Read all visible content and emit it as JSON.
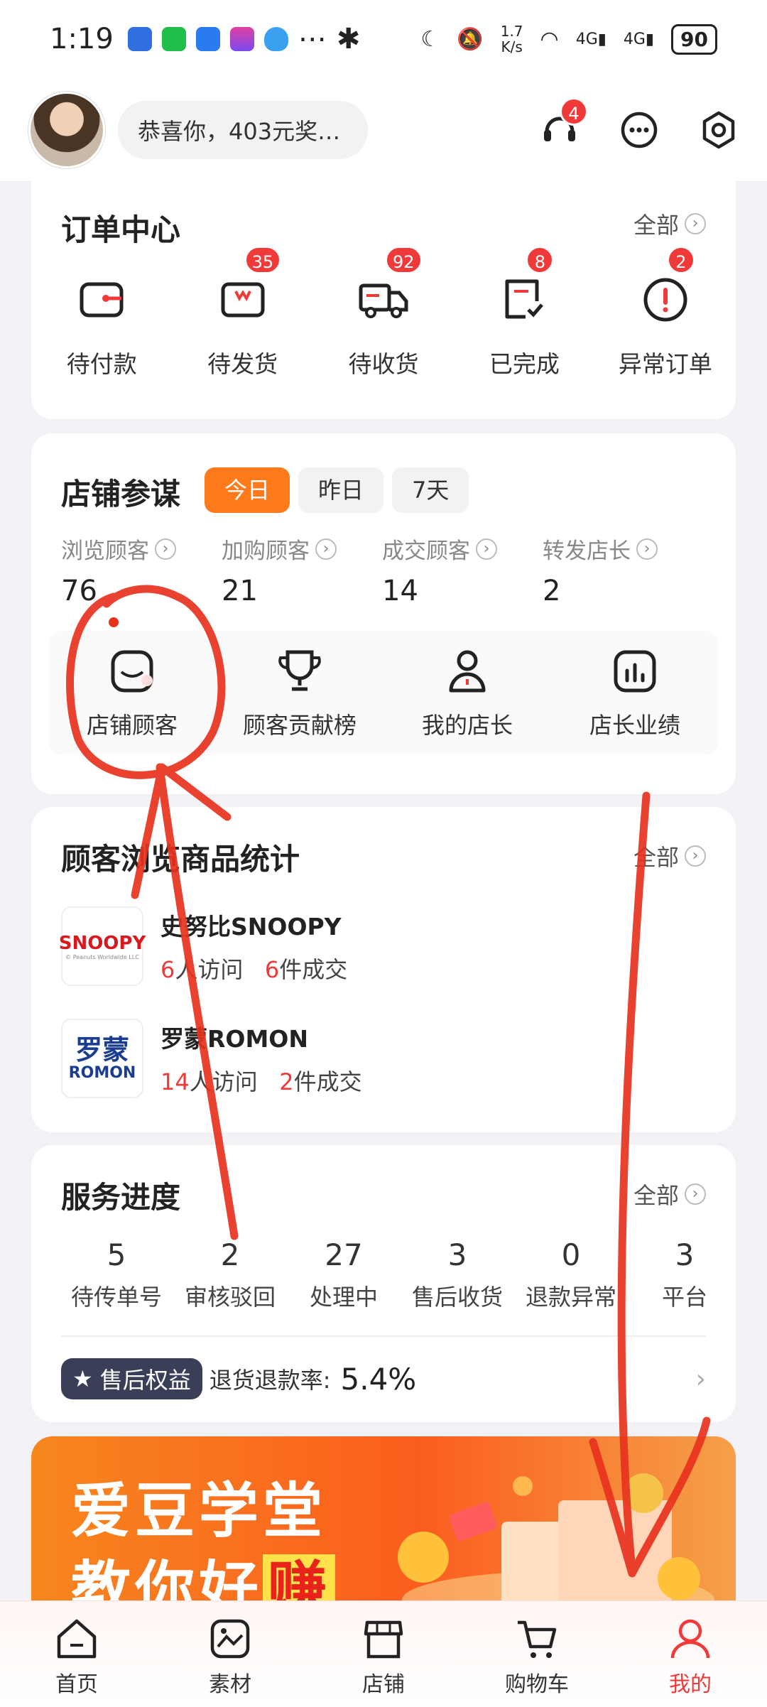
{
  "status_bar": {
    "time": "1:19",
    "net_speed_top": "1.7",
    "net_speed_bottom": "K/s",
    "network_1": "4G",
    "network_2": "4G",
    "battery": "90"
  },
  "header": {
    "message": "恭喜你，403元奖…",
    "service_badge": "4"
  },
  "orders": {
    "title": "订单中心",
    "all_label": "全部",
    "items": [
      {
        "label": "待付款",
        "badge": ""
      },
      {
        "label": "待发货",
        "badge": "35"
      },
      {
        "label": "待收货",
        "badge": "92"
      },
      {
        "label": "已完成",
        "badge": "8"
      },
      {
        "label": "异常订单",
        "badge": "2"
      }
    ]
  },
  "store": {
    "title": "店铺参谋",
    "tabs": [
      "今日",
      "昨日",
      "7天"
    ],
    "active_tab": "今日",
    "stats": [
      {
        "label": "浏览顾客",
        "value": "76"
      },
      {
        "label": "加购顾客",
        "value": "21"
      },
      {
        "label": "成交顾客",
        "value": "14"
      },
      {
        "label": "转发店长",
        "value": "2"
      }
    ],
    "tools": [
      "店铺顾客",
      "顾客贡献榜",
      "我的店长",
      "店长业绩"
    ]
  },
  "browse": {
    "title": "顾客浏览商品统计",
    "all_label": "全部",
    "brands": [
      {
        "name": "史努比SNOOPY",
        "visits": "6",
        "visits_label": "人访问",
        "deals": "6",
        "deals_label": "件成交",
        "logo_text": "SNOOPY",
        "logo_sub": "© Peanuts Worldwide LLC"
      },
      {
        "name": "罗蒙ROMON",
        "visits": "14",
        "visits_label": "人访问",
        "deals": "2",
        "deals_label": "件成交",
        "logo_text": "罗蒙",
        "logo_sub": "ROMON"
      }
    ]
  },
  "service": {
    "title": "服务进度",
    "all_label": "全部",
    "items": [
      {
        "value": "5",
        "label": "待传单号"
      },
      {
        "value": "2",
        "label": "审核驳回"
      },
      {
        "value": "27",
        "label": "处理中"
      },
      {
        "value": "3",
        "label": "售后收货"
      },
      {
        "value": "0",
        "label": "退款异常"
      },
      {
        "value": "3",
        "label": "平台"
      }
    ],
    "after_sale_label": "售后权益",
    "refund_rate_label": "退货退款率:",
    "refund_rate": "5.4%"
  },
  "banner": {
    "line1": "爱豆学堂",
    "line2_prefix": "教你好",
    "line2_highlight": "赚"
  },
  "tabbar": {
    "items": [
      "首页",
      "素材",
      "店铺",
      "购物车",
      "我的"
    ],
    "active": "我的"
  },
  "colors": {
    "accent": "#ff7a1a",
    "badge_red": "#f03a3a",
    "annotation": "#e8321e"
  }
}
